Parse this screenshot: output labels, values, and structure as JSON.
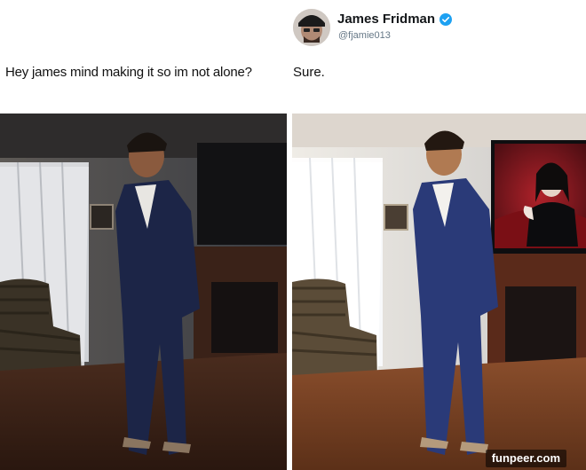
{
  "post": {
    "request_text": "Hey james mind making it so im not alone?",
    "reply_text": "Sure."
  },
  "account": {
    "display_name": "James Fridman",
    "handle": "@fjamie013",
    "verified": true,
    "verified_color": "#1da1f2"
  },
  "photos": {
    "original_tone": "#3a3a40",
    "edited_tone": "#6a5a50"
  },
  "watermark": "funpeer.com",
  "icons": [
    "verified-badge-icon"
  ]
}
